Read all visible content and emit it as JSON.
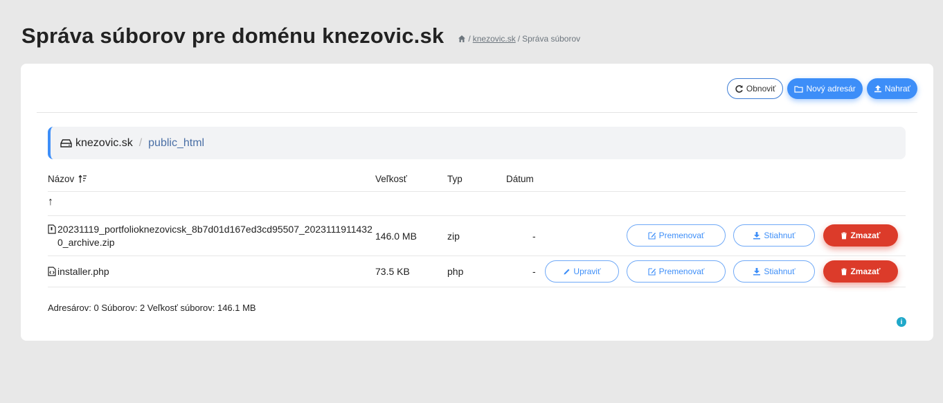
{
  "header": {
    "title": "Správa súborov pre doménu knezovic.sk",
    "breadcrumb": {
      "sep1": "/",
      "link": "knezovic.sk",
      "sep2": "/",
      "current": "Správa súborov"
    }
  },
  "toolbar": {
    "refresh_label": "Obnoviť",
    "new_dir_label": "Nový adresár",
    "upload_label": "Nahrať"
  },
  "path": {
    "root": "knezovic.sk",
    "separator": "/",
    "current": "public_html"
  },
  "table": {
    "columns": {
      "name": "Názov",
      "size": "Veľkosť",
      "type": "Typ",
      "date": "Dátum"
    },
    "up_symbol": "↑",
    "rows": [
      {
        "name": "20231119_portfolioknezovicsk_8b7d01d167ed3cd95507_20231119114320_archive.zip",
        "size": "146.0 MB",
        "type": "zip",
        "date": "-",
        "actions": {
          "rename": "Premenovať",
          "download": "Stiahnuť",
          "delete": "Zmazať"
        }
      },
      {
        "name": "installer.php",
        "size": "73.5 KB",
        "type": "php",
        "date": "-",
        "actions": {
          "edit": "Upraviť",
          "rename": "Premenovať",
          "download": "Stiahnuť",
          "delete": "Zmazať"
        }
      }
    ]
  },
  "summary": "Adresárov: 0 Súborov: 2 Veľkosť súborov: 146.1 MB",
  "info_symbol": "i",
  "colors": {
    "primary": "#3d8ef8",
    "danger": "#dc3b2a",
    "background": "#e8e8e8",
    "info": "#20a8c9"
  }
}
